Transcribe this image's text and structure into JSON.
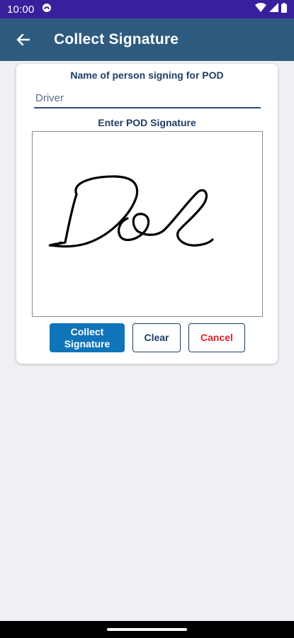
{
  "status_bar": {
    "time": "10:00",
    "icons": [
      "app-notification-icon",
      "wifi-icon",
      "signal-icon",
      "battery-icon"
    ]
  },
  "app_bar": {
    "title": "Collect Signature",
    "back_icon": "arrow-left-icon"
  },
  "form": {
    "name_label": "Name of person signing for POD",
    "name_placeholder": "Driver",
    "signature_label": "Enter POD Signature",
    "signature_text": "Doe"
  },
  "buttons": {
    "collect_line1": "Collect",
    "collect_line2": "Signature",
    "clear": "Clear",
    "cancel": "Cancel"
  },
  "colors": {
    "status_bar": "#3a1f9c",
    "app_bar": "#2e5a7e",
    "primary_button": "#0f74b8",
    "label_text": "#1f3d67",
    "cancel_text": "#e0232b",
    "background": "#eff0f3"
  }
}
